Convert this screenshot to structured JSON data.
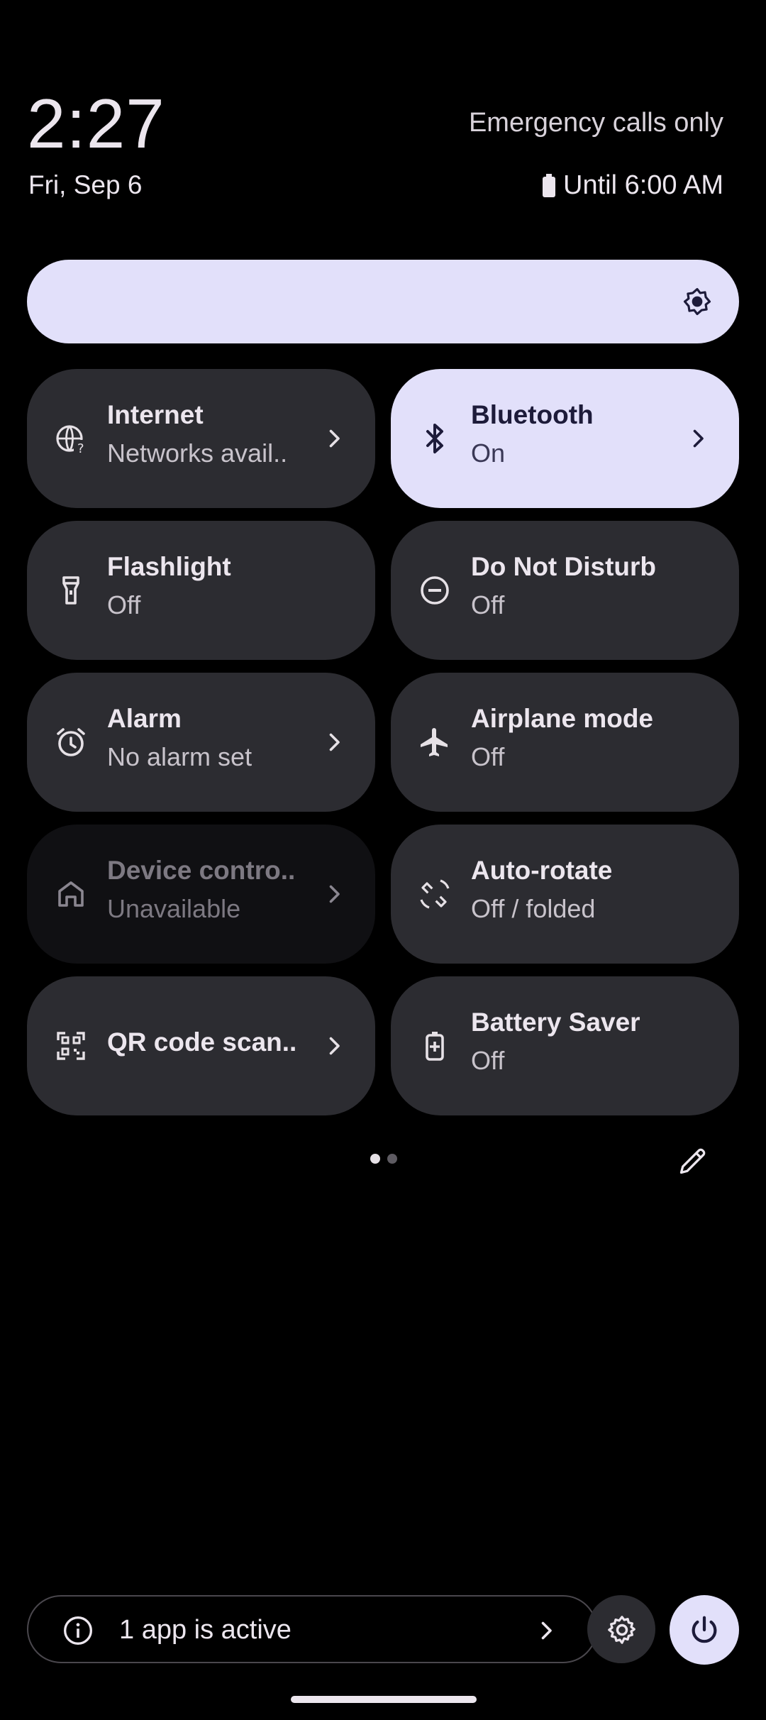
{
  "status": {
    "time": "2:27",
    "date": "Fri, Sep 6",
    "network": "Emergency calls only",
    "battery": "Until 6:00 AM"
  },
  "brightness": {
    "icon": "brightness-icon"
  },
  "tiles": [
    {
      "title": "Internet",
      "subtitle": "Networks avail..",
      "icon": "internet-icon",
      "state": "off",
      "has_chevron": true
    },
    {
      "title": "Bluetooth",
      "subtitle": "On",
      "icon": "bluetooth-icon",
      "state": "on",
      "has_chevron": true
    },
    {
      "title": "Flashlight",
      "subtitle": "Off",
      "icon": "flashlight-icon",
      "state": "off",
      "has_chevron": false
    },
    {
      "title": "Do Not Disturb",
      "subtitle": "Off",
      "icon": "do-not-disturb-icon",
      "state": "off",
      "has_chevron": false
    },
    {
      "title": "Alarm",
      "subtitle": "No alarm set",
      "icon": "alarm-icon",
      "state": "off",
      "has_chevron": true
    },
    {
      "title": "Airplane mode",
      "subtitle": "Off",
      "icon": "airplane-icon",
      "state": "off",
      "has_chevron": false
    },
    {
      "title": "Device contro..",
      "subtitle": "Unavailable",
      "icon": "home-icon",
      "state": "unavailable",
      "has_chevron": true
    },
    {
      "title": "Auto-rotate",
      "subtitle": "Off / folded",
      "icon": "auto-rotate-icon",
      "state": "off",
      "has_chevron": false
    },
    {
      "title": "QR code scan..",
      "subtitle": "",
      "icon": "qr-code-icon",
      "state": "off",
      "has_chevron": true
    },
    {
      "title": "Battery Saver",
      "subtitle": "Off",
      "icon": "battery-saver-icon",
      "state": "off",
      "has_chevron": false
    }
  ],
  "pager": {
    "pages": 2,
    "current": 1
  },
  "footer": {
    "active_apps": "1 app is active"
  },
  "colors": {
    "background": "#000000",
    "tile": "#2c2c31",
    "tile_active": "#e2e0fa",
    "tile_unavailable": "#101013"
  }
}
